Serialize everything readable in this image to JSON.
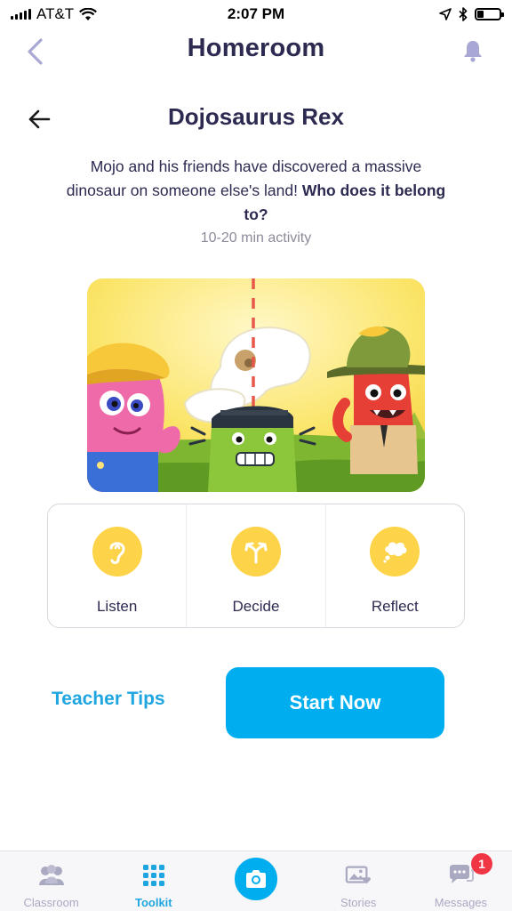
{
  "status_bar": {
    "carrier": "AT&T",
    "time": "2:07 PM"
  },
  "nav": {
    "title": "Homeroom",
    "back_icon": "chevron-left-icon",
    "bell_icon": "bell-icon"
  },
  "activity": {
    "title": "Dojosaurus Rex",
    "description_plain": "Mojo and his friends have discovered a massive dinosaur on someone else's land!",
    "description_bold": "Who does it belong to?",
    "duration": "10-20 min activity"
  },
  "steps": [
    {
      "label": "Listen",
      "icon": "ear-icon"
    },
    {
      "label": "Decide",
      "icon": "split-arrows-icon"
    },
    {
      "label": "Reflect",
      "icon": "thought-bubble-icon"
    }
  ],
  "actions": {
    "teacher_tips": "Teacher Tips",
    "start_now": "Start Now"
  },
  "tabs": [
    {
      "label": "Classroom",
      "icon": "classroom-icon",
      "active": false
    },
    {
      "label": "Toolkit",
      "icon": "grid-icon",
      "active": true
    },
    {
      "label": "",
      "icon": "camera-icon",
      "active": false
    },
    {
      "label": "Stories",
      "icon": "stories-icon",
      "active": false
    },
    {
      "label": "Messages",
      "icon": "messages-icon",
      "active": false,
      "badge": "1"
    }
  ],
  "colors": {
    "primary_text": "#2c2a50",
    "accent_blue": "#00aef0",
    "step_yellow": "#fdd34a",
    "badge_red": "#f03545"
  }
}
